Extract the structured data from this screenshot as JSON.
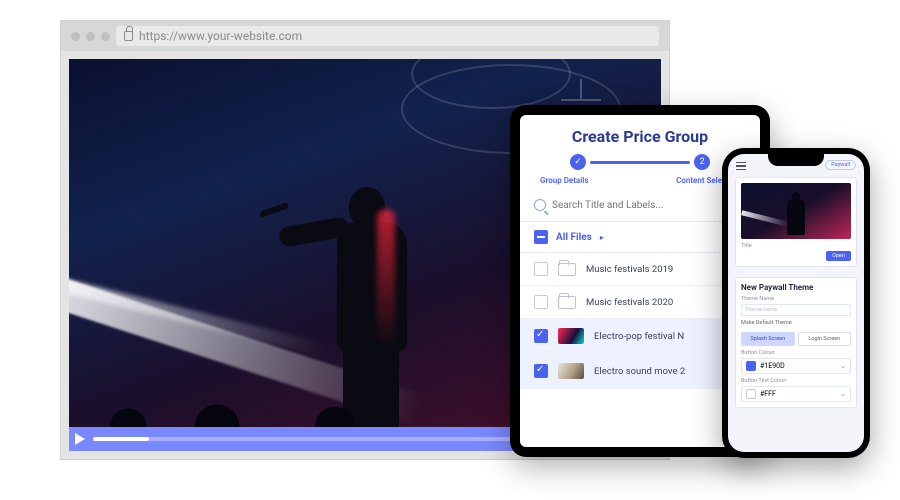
{
  "browser": {
    "url": "https://www.your-website.com"
  },
  "video": {
    "progress_percent": 10
  },
  "tablet": {
    "title": "Create Price Group",
    "step1_label": "Group Details",
    "step2_label": "Content Selection",
    "step2_number": "2",
    "search_placeholder": "Search Title and Labels...",
    "all_files_label": "All Files",
    "rows": [
      {
        "type": "folder",
        "checked": false,
        "label": "Music festivals 2019"
      },
      {
        "type": "folder",
        "checked": false,
        "label": "Music festivals 2020"
      },
      {
        "type": "video",
        "checked": true,
        "label": "Electro-pop festival N",
        "thumb": "a"
      },
      {
        "type": "video",
        "checked": true,
        "label": "Electro sound move 2",
        "thumb": "b"
      }
    ]
  },
  "phone": {
    "header_button": "Paywall",
    "card_title": "Title",
    "card_button": "Open",
    "section_title": "New Paywall Theme",
    "theme_name_label": "Theme Name",
    "theme_name_placeholder": "Theme name",
    "make_default_label": "Make Default Theme",
    "tab_splash": "Splash Screen",
    "tab_login": "Login Screen",
    "button_colour_label": "Button Colour",
    "button_colour_value": "#1E90D",
    "button_text_colour_label": "Button Text Colour",
    "button_text_colour_value": "#FFF"
  },
  "colors": {
    "accent": "#4a62f0"
  }
}
